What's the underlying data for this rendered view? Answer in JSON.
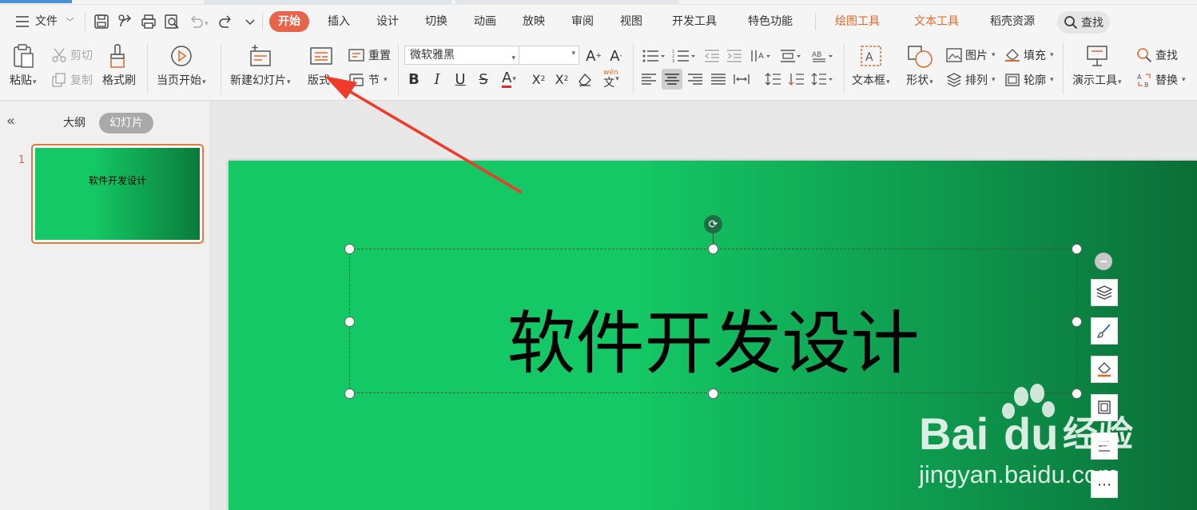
{
  "menubar": {
    "file_label": "文件",
    "tabs": [
      {
        "label": "开始",
        "active": true
      },
      {
        "label": "插入"
      },
      {
        "label": "设计"
      },
      {
        "label": "切换"
      },
      {
        "label": "动画"
      },
      {
        "label": "放映"
      },
      {
        "label": "审阅"
      },
      {
        "label": "视图"
      },
      {
        "label": "开发工具"
      },
      {
        "label": "特色功能"
      },
      {
        "label": "绘图工具",
        "highlight": true
      },
      {
        "label": "文本工具",
        "highlight": true
      },
      {
        "label": "稻壳资源"
      }
    ],
    "search_label": "查找"
  },
  "ribbon": {
    "paste": "粘贴",
    "cut": "剪切",
    "copy": "复制",
    "format_painter": "格式刷",
    "from_current": "当页开始",
    "new_slide": "新建幻灯片",
    "layout": "版式",
    "reset": "重置",
    "section": "节",
    "font_name": "微软雅黑",
    "font_size": "",
    "textbox": "文本框",
    "shape": "形状",
    "picture": "图片",
    "fill": "填充",
    "arrange": "排列",
    "outline": "轮廓",
    "presentation_tools": "演示工具",
    "find": "查找",
    "replace": "替换"
  },
  "leftpanel": {
    "tab_outline": "大纲",
    "tab_slides": "幻灯片",
    "slides": [
      {
        "number": "1",
        "title": "软件开发设计"
      }
    ]
  },
  "slide": {
    "title": "软件开发设计"
  },
  "watermark": {
    "brand": "Bai",
    "brand2": "du",
    "suffix": "经验",
    "url": "jingyan.baidu.com"
  },
  "colors": {
    "accent_orange": "#e7634a",
    "slide_green": "#14c865",
    "slide_dark_green": "#0b6e37",
    "annotation_arrow": "#f03a2a"
  }
}
